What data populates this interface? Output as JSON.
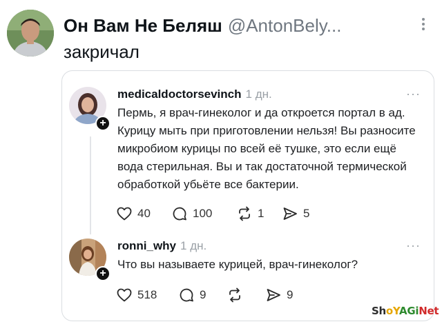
{
  "tweet": {
    "author_name": "Он Вам Не Беляш",
    "author_handle": "@AntonBely...",
    "text": "закричал"
  },
  "quote": {
    "posts": [
      {
        "username": "medicaldoctorsevinch",
        "time": "1 дн.",
        "more": "···",
        "text": "Пермь, я врач-гинеколог и да откроется портал в ад. Курицу мыть при приготовлении нельзя! Вы разносите микробиом курицы по всей её тушке, это если ещё вода стерильная. Вы и так достаточной термической обработкой убьёте все бактерии.",
        "likes": "40",
        "replies": "100",
        "reposts": "1",
        "shares": "5"
      },
      {
        "username": "ronni_why",
        "time": "1 дн.",
        "more": "···",
        "text": "Что вы называете курицей, врач-гинеколог?",
        "likes": "518",
        "replies": "9",
        "reposts": "",
        "shares": "9"
      }
    ]
  },
  "watermark": {
    "part1": "Sh",
    "part2": "oY",
    "part3": "AGi",
    "part4": "Net"
  }
}
